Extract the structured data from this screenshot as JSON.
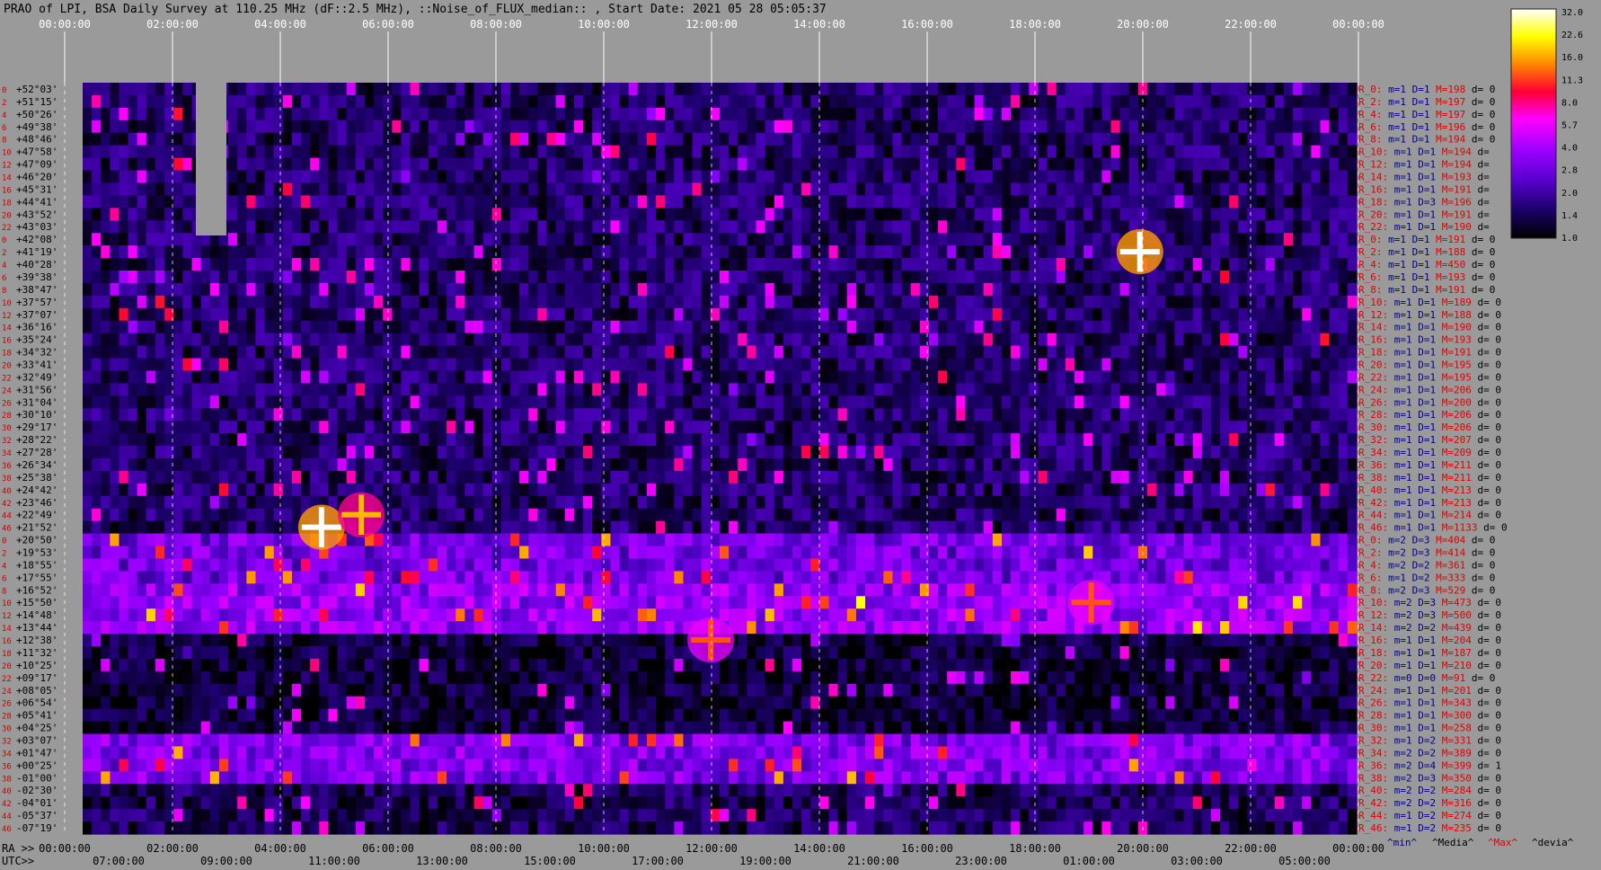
{
  "header": {
    "title": "PRAO of LPI, BSA Daily Survey at 110.25 MHz (dF::2.5 MHz), ::Noise_of_FLUX_median:: , Start Date: 2021 05 28 05:05:37"
  },
  "footer": {
    "ra_label": "RA >>",
    "utc_label": "UTC>>",
    "legend_min": "^min^",
    "legend_media": "^Media^",
    "legend_max": "^Max^",
    "legend_devia": "^devia^"
  },
  "colorbar": {
    "ticks": [
      "32.0",
      "22.6",
      "16.0",
      "11.3",
      "8.0",
      "5.7",
      "4.0",
      "2.8",
      "2.0",
      "1.4",
      "1.0"
    ]
  },
  "chart_data": {
    "type": "heatmap",
    "title": "PRAO of LPI, BSA Daily Survey at 110.25 MHz (dF::2.5 MHz), ::Noise_of_FLUX_median:: , Start Date: 2021 05 28 05:05:37",
    "top_time_ticks": [
      "00:00:00",
      "02:00:00",
      "04:00:00",
      "06:00:00",
      "08:00:00",
      "10:00:00",
      "12:00:00",
      "14:00:00",
      "16:00:00",
      "18:00:00",
      "20:00:00",
      "22:00:00",
      "00:00:00"
    ],
    "ra_ticks": [
      "00:00:00",
      "02:00:00",
      "04:00:00",
      "06:00:00",
      "08:00:00",
      "10:00:00",
      "12:00:00",
      "14:00:00",
      "16:00:00",
      "18:00:00",
      "20:00:00",
      "22:00:00",
      "00:00:00"
    ],
    "utc_ticks": [
      "07:00:00",
      "09:00:00",
      "11:00:00",
      "13:00:00",
      "15:00:00",
      "17:00:00",
      "19:00:00",
      "21:00:00",
      "23:00:00",
      "01:00:00",
      "03:00:00",
      "05:00:00"
    ],
    "declinations": [
      "+52°03'",
      "+51°15'",
      "+50°26'",
      "+49°38'",
      "+48°46'",
      "+47°58'",
      "+47°09'",
      "+46°20'",
      "+45°31'",
      "+44°41'",
      "+43°52'",
      "+43°03'",
      "+42°08'",
      "+41°19'",
      "+40°28'",
      "+39°38'",
      "+38°47'",
      "+37°57'",
      "+37°07'",
      "+36°16'",
      "+35°24'",
      "+34°32'",
      "+33°41'",
      "+32°49'",
      "+31°56'",
      "+31°04'",
      "+30°10'",
      "+29°17'",
      "+28°22'",
      "+27°28'",
      "+26°34'",
      "+25°38'",
      "+24°42'",
      "+23°46'",
      "+22°49'",
      "+21°52'",
      "+20°50'",
      "+19°53'",
      "+18°55'",
      "+17°55'",
      "+16°52'",
      "+15°50'",
      "+14°48'",
      "+13°44'",
      "+12°38'",
      "+11°32'",
      "+10°25'",
      "+09°17'",
      "+08°05'",
      "+06°54'",
      "+05°41'",
      "+04°25'",
      "+03°07'",
      "+01°47'",
      "+00°25'",
      "-01°00'",
      "-02°30'",
      "-04°01'",
      "-05°37'",
      "-07°19'"
    ],
    "row_indices": [
      "0",
      "2",
      "4",
      "6",
      "8",
      "10",
      "12",
      "14",
      "16",
      "18",
      "20",
      "22",
      "0",
      "2",
      "4",
      "6",
      "8",
      "10",
      "12",
      "14",
      "16",
      "18",
      "20",
      "22",
      "24",
      "26",
      "28",
      "30",
      "32",
      "34",
      "36",
      "38",
      "40",
      "42",
      "44",
      "46",
      "0",
      "2",
      "4",
      "6",
      "8",
      "10",
      "12",
      "14",
      "16",
      "18",
      "20",
      "22",
      "24",
      "26",
      "28",
      "30",
      "32",
      "34",
      "36",
      "38",
      "40",
      "42",
      "44",
      "46"
    ],
    "right_stats": [
      "R_0: m=1 D=1 M=198 d= 0",
      "R_2: m=1 D=1 M=197 d= 0",
      "R_4: m=1 D=1 M=197 d= 0",
      "R_6: m=1 D=1 M=196 d= 0",
      "R_8: m=1 D=1 M=194 d= 0",
      "R_10: m=1 D=1 M=194 d=",
      "R_12: m=1 D=1 M=194 d=",
      "R_14: m=1 D=1 M=193 d=",
      "R_16: m=1 D=1 M=191 d=",
      "R_18: m=1 D=3 M=196 d=",
      "R_20: m=1 D=1 M=191 d=",
      "R_22: m=1 D=1 M=190 d=",
      "R_0: m=1 D=1 M=191 d= 0",
      "R_2: m=1 D=1 M=188 d= 0",
      "R_4: m=1 D=1 M=450 d= 0",
      "R_6: m=1 D=1 M=193 d= 0",
      "R_8: m=1 D=1 M=191 d= 0",
      "R_10: m=1 D=1 M=189 d= 0",
      "R_12: m=1 D=1 M=188 d= 0",
      "R_14: m=1 D=1 M=190 d= 0",
      "R_16: m=1 D=1 M=193 d= 0",
      "R_18: m=1 D=1 M=191 d= 0",
      "R_20: m=1 D=1 M=195 d= 0",
      "R_22: m=1 D=1 M=195 d= 0",
      "R_24: m=1 D=1 M=206 d= 0",
      "R_26: m=1 D=1 M=200 d= 0",
      "R_28: m=1 D=1 M=206 d= 0",
      "R_30: m=1 D=1 M=206 d= 0",
      "R_32: m=1 D=1 M=207 d= 0",
      "R_34: m=1 D=1 M=209 d= 0",
      "R_36: m=1 D=1 M=211 d= 0",
      "R_38: m=1 D=1 M=211 d= 0",
      "R_40: m=1 D=1 M=213 d= 0",
      "R_42: m=1 D=1 M=213 d= 0",
      "R_44: m=1 D=1 M=214 d= 0",
      "R_46: m=1 D=1 M=1133 d= 0",
      "R_0: m=2 D=3 M=404 d= 0",
      "R_2: m=2 D=3 M=414 d= 0",
      "R_4: m=2 D=2 M=361 d= 0",
      "R_6: m=1 D=2 M=333 d= 0",
      "R_8: m=2 D=3 M=529 d= 0",
      "R_10: m=2 D=3 M=473 d= 0",
      "R_12: m=2 D=3 M=500 d= 0",
      "R_14: m=2 D=2 M=439 d= 0",
      "R_16: m=1 D=1 M=204 d= 0",
      "R_18: m=1 D=1 M=187 d= 0",
      "R_20: m=1 D=1 M=210 d= 0",
      "R_22: m=0 D=0 M=91 d= 0",
      "R_24: m=1 D=1 M=201 d= 0",
      "R_26: m=1 D=1 M=343 d= 0",
      "R_28: m=1 D=1 M=300 d= 0",
      "R_30: m=1 D=1 M=258 d= 0",
      "R_32: m=1 D=2 M=331 d= 0",
      "R_34: m=2 D=2 M=389 d= 0",
      "R_36: m=2 D=4 M=399 d= 1",
      "R_38: m=2 D=3 M=350 d= 0",
      "R_40: m=2 D=2 M=284 d= 0",
      "R_42: m=2 D=2 M=316 d= 0",
      "R_44: m=1 D=2 M=274 d= 0",
      "R_46: m=1 D=2 M=235 d= 0"
    ],
    "colorbar_range": [
      1.0,
      32.0
    ],
    "colorscale": [
      "#000000",
      "#1a0066",
      "#5500cc",
      "#9900ff",
      "#ff00ff",
      "#ff0033",
      "#ff8800",
      "#ffff00",
      "#ffffff"
    ],
    "band_means": [
      {
        "rows": [
          0,
          35
        ],
        "level": 1.6
      },
      {
        "rows": [
          36,
          39
        ],
        "level": 3.0
      },
      {
        "rows": [
          40,
          43
        ],
        "level": 3.6
      },
      {
        "rows": [
          44,
          51
        ],
        "level": 1.3
      },
      {
        "rows": [
          52,
          55
        ],
        "level": 3.2
      },
      {
        "rows": [
          56,
          59
        ],
        "level": 1.5
      }
    ],
    "sources": [
      {
        "ra": "19:55",
        "dec": "+41°19'",
        "level": 32.0
      },
      {
        "ra": "04:30",
        "dec": "+21°52'",
        "level": 32.0
      },
      {
        "ra": "19:00",
        "dec": "+15°50'",
        "level": 11.3
      },
      {
        "ra": "11:50",
        "dec": "+12°38'",
        "level": 11.3
      },
      {
        "ra": "05:15",
        "dec": "+22°49'",
        "level": 16.0
      }
    ]
  }
}
